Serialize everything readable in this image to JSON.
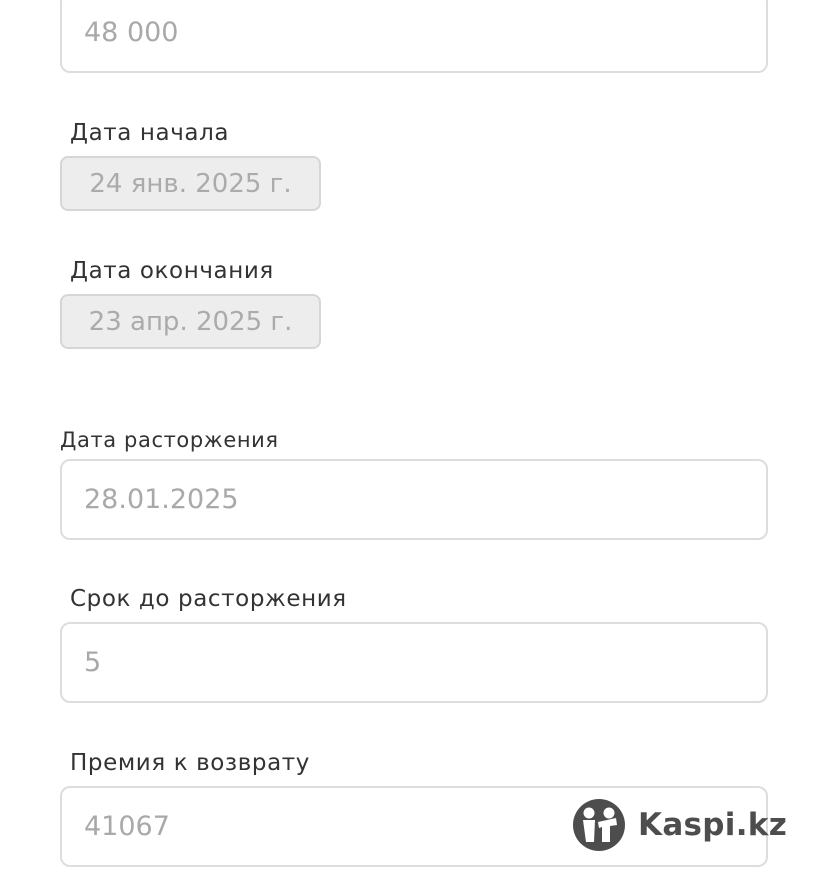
{
  "form": {
    "top_field": {
      "value": "48 000"
    },
    "start_date": {
      "label": "Дата начала",
      "value": "24 янв. 2025 г."
    },
    "end_date": {
      "label": "Дата окончания",
      "value": "23 апр. 2025 г."
    },
    "termination_date": {
      "label": "Дата расторжения",
      "value": "28.01.2025"
    },
    "term_until_termination": {
      "label": "Срок до расторжения",
      "value": "5"
    },
    "refund_premium": {
      "label": "Премия к возврату",
      "value": "41067"
    }
  },
  "watermark": {
    "icon": "kaspi-logo-icon",
    "text": "Kaspi.kz"
  }
}
